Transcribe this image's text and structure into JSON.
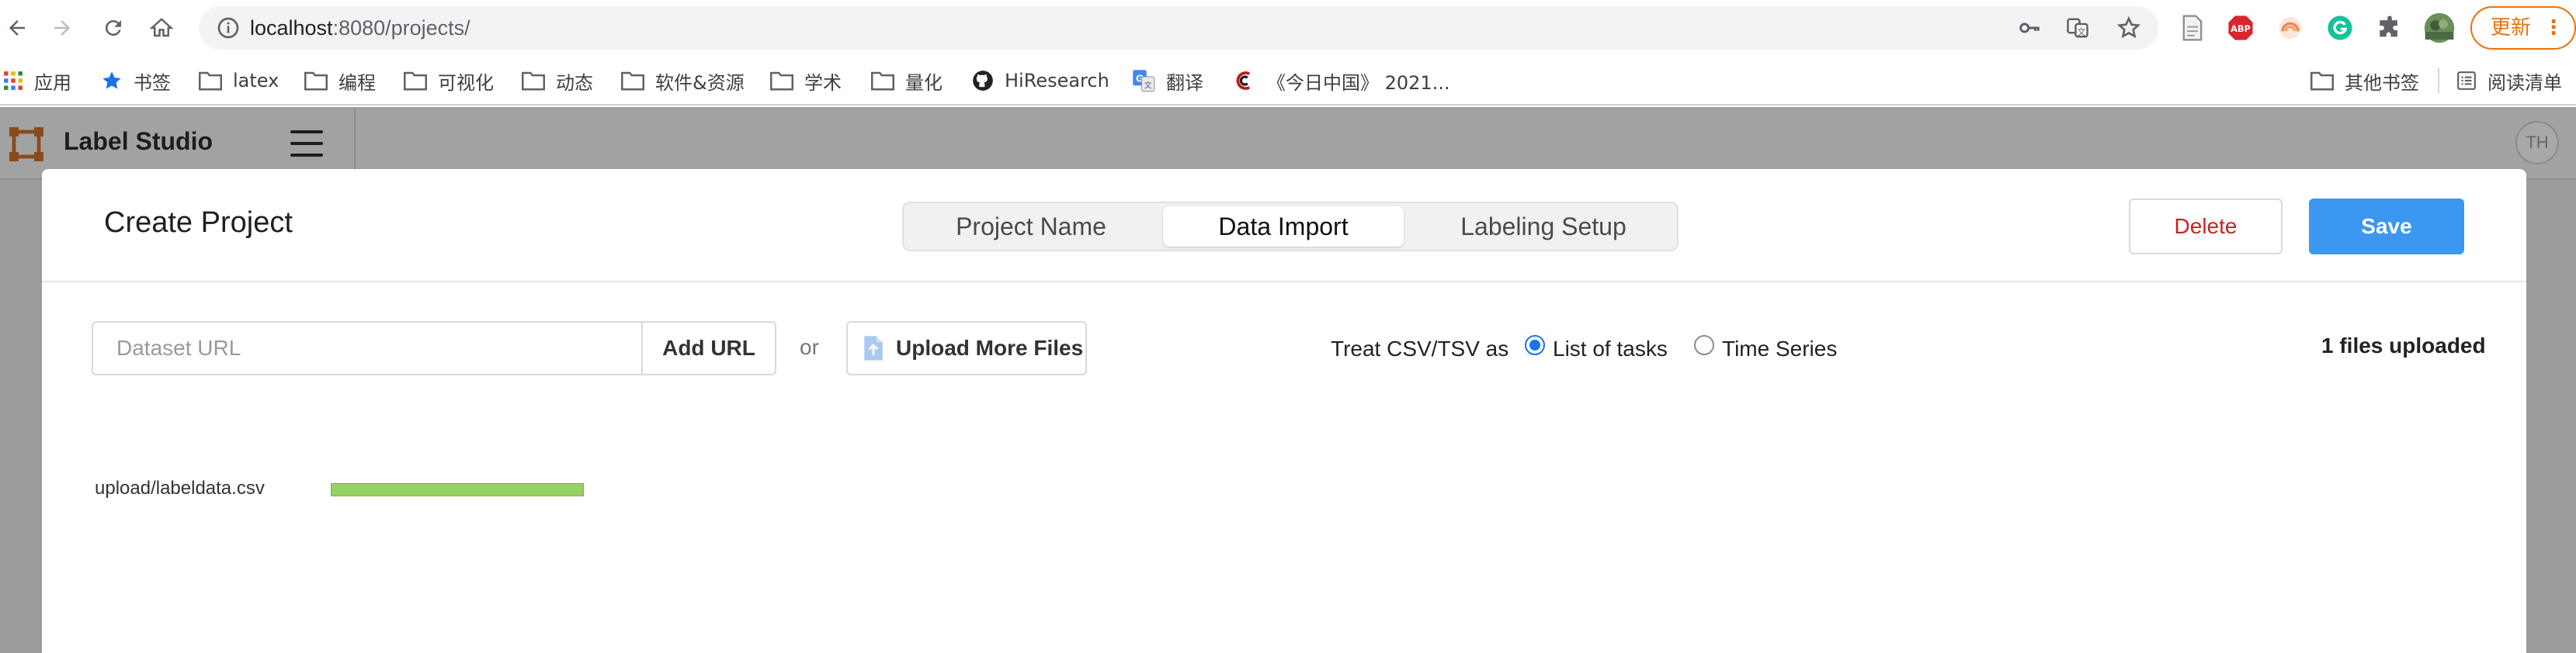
{
  "browser": {
    "url_host": "localhost",
    "url_rest": ":8080/projects/",
    "update_label": "更新",
    "update_more": "⋮"
  },
  "bookmarks": {
    "items": [
      {
        "label": "应用",
        "icon": "apps-grid-icon"
      },
      {
        "label": "书签",
        "icon": "star-icon"
      },
      {
        "label": "latex",
        "icon": "folder-icon"
      },
      {
        "label": "编程",
        "icon": "folder-icon"
      },
      {
        "label": "可视化",
        "icon": "folder-icon"
      },
      {
        "label": "动态",
        "icon": "folder-icon"
      },
      {
        "label": "软件&资源",
        "icon": "folder-icon"
      },
      {
        "label": "学术",
        "icon": "folder-icon"
      },
      {
        "label": "量化",
        "icon": "folder-icon"
      },
      {
        "label": "HiResearch",
        "icon": "github-icon"
      },
      {
        "label": "翻译",
        "icon": "translate-icon"
      },
      {
        "label": "《今日中国》 2021...",
        "icon": "site-logo-icon"
      }
    ],
    "other_bookmarks": "其他书签",
    "reading_list": "阅读清单"
  },
  "app": {
    "name": "Label Studio",
    "user_initials": "TH"
  },
  "modal": {
    "title": "Create Project",
    "tabs": [
      {
        "label": "Project Name",
        "active": false
      },
      {
        "label": "Data Import",
        "active": true
      },
      {
        "label": "Labeling Setup",
        "active": false
      }
    ],
    "delete_label": "Delete",
    "save_label": "Save"
  },
  "import": {
    "url_placeholder": "Dataset URL",
    "add_url_label": "Add URL",
    "or_label": "or",
    "upload_label": "Upload More Files",
    "treat_label": "Treat CSV/TSV as",
    "options": [
      {
        "label": "List of tasks",
        "checked": true
      },
      {
        "label": "Time Series",
        "checked": false
      }
    ],
    "files_uploaded": "1 files uploaded",
    "files": [
      {
        "name": "upload/labeldata.csv",
        "progress": 1.0
      }
    ]
  },
  "colors": {
    "accent": "#3b97ef",
    "danger": "#c82323",
    "progress": "#95d163",
    "update": "#e8710a"
  }
}
